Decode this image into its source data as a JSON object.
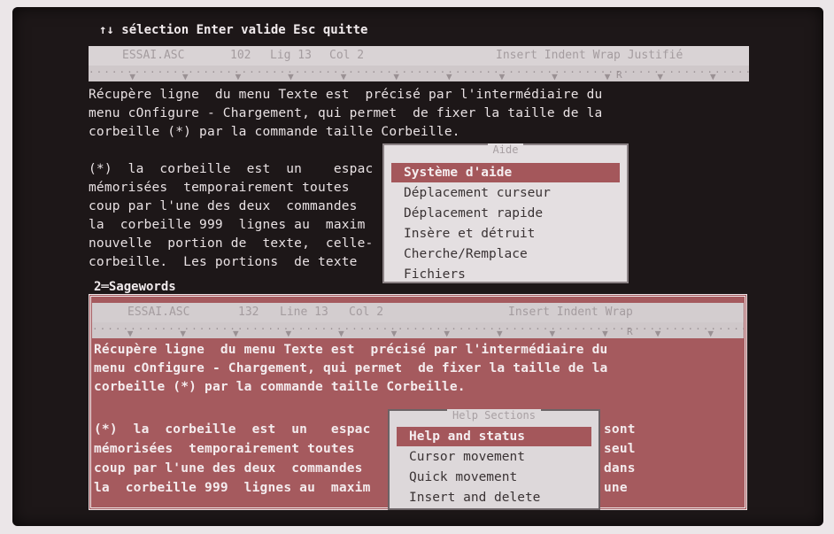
{
  "hint": "↑↓ sélection Enter valide Esc quitte",
  "top_status": {
    "file": "ESSAI.ASC",
    "size": "102",
    "line": "Lig 13",
    "col": "Col 2",
    "modes": "Insert Indent Wrap Justifié"
  },
  "top_ruler": "R",
  "top_text": [
    "Récupère ligne  du menu Texte est  précisé par l'intermédiaire du",
    "menu cOnfigure - Chargement, qui permet  de fixer la taille de la",
    "corbeille (*) par la commande taille Corbeille.",
    "",
    "(*)  la  corbeille  est  un    espac",
    "mémorisées  temporairement toutes",
    "coup par l'une des deux  commandes",
    "la  corbeille 999  lignes au  maxim",
    "nouvelle  portion de  texte,  celle-",
    "corbeille.  Les portions  de texte"
  ],
  "aide_menu": {
    "title": "Aide",
    "items": [
      "Système d'aide",
      "Déplacement curseur",
      "Déplacement rapide",
      "Insère et détruit",
      "Cherche/Remplace",
      "Fichiers"
    ],
    "selected_index": 0
  },
  "win2": {
    "title": "2═Sagewords",
    "status": {
      "file": "ESSAI.ASC",
      "size": "132",
      "line": "Line 13",
      "col": "Col 2",
      "modes": "Insert Indent Wrap"
    },
    "ruler": "R",
    "text": [
      "Récupère ligne  du menu Texte est  précisé par l'intermédiaire du",
      "menu cOnfigure - Chargement, qui permet  de fixer la taille de la",
      "corbeille (*) par la commande taille Corbeille.",
      "",
      "(*)  la  corbeille  est  un   espac",
      "mémorisées  temporairement toutes",
      "coup par l'une des deux  commandes",
      "la  corbeille 999  lignes au  maxim"
    ],
    "right_fragments": [
      "sont",
      "seul",
      "dans",
      "une"
    ]
  },
  "help_menu": {
    "title": "Help Sections",
    "items": [
      "Help and status",
      "Cursor movement",
      "Quick movement",
      "Insert and delete"
    ],
    "selected_index": 0
  },
  "colors": {
    "screen_bg": "#1d1718",
    "window2_bg": "#a55a5e",
    "menu_bg": "#e4dfe1",
    "menu_highlight": "#a4575b"
  }
}
